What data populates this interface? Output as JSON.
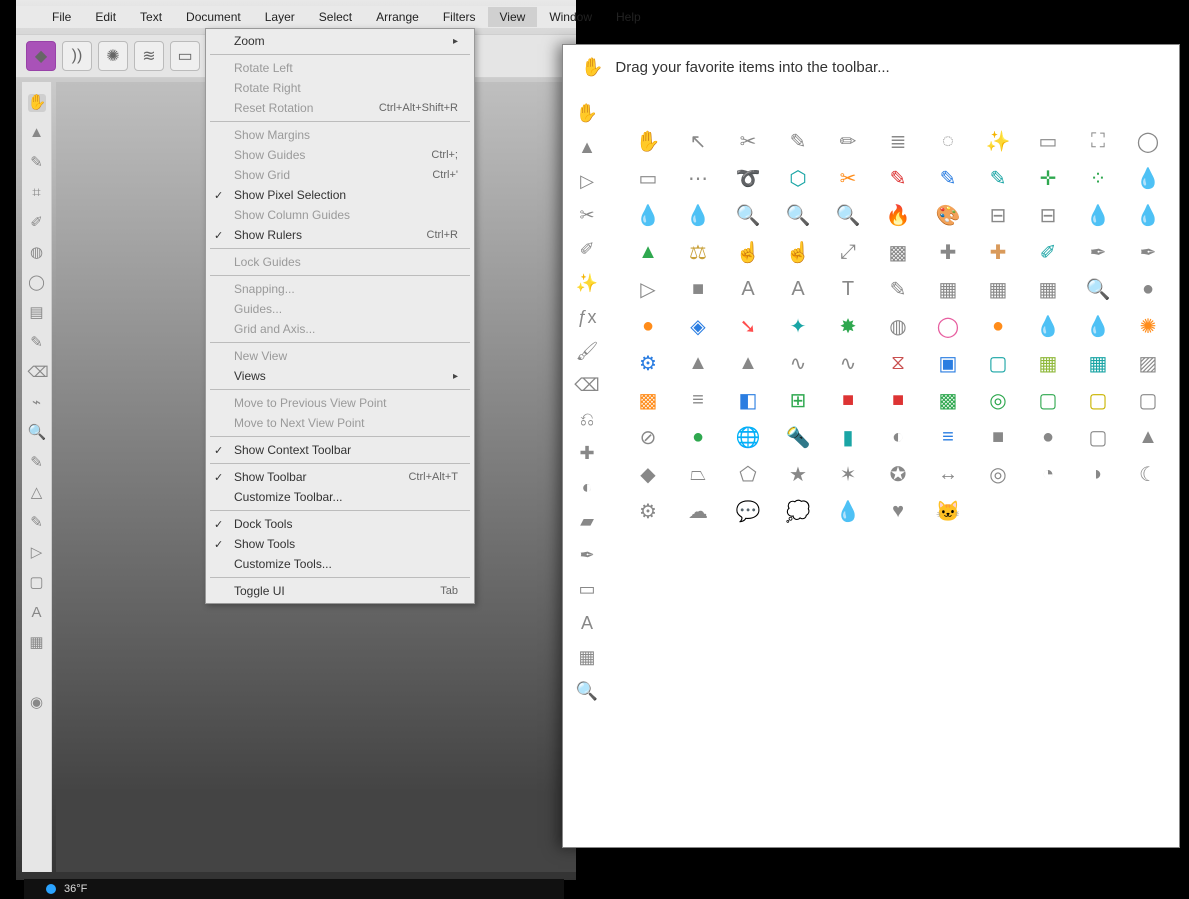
{
  "menubar": {
    "items": [
      "File",
      "Edit",
      "Text",
      "Document",
      "Layer",
      "Select",
      "Arrange",
      "Filters",
      "View",
      "Window",
      "Help"
    ],
    "active": "View"
  },
  "view_menu": {
    "groups": [
      [
        {
          "label": "Zoom",
          "arrow": true,
          "dim": false
        }
      ],
      [
        {
          "label": "Rotate Left",
          "dim": true
        },
        {
          "label": "Rotate Right",
          "dim": true
        },
        {
          "label": "Reset Rotation",
          "shortcut": "Ctrl+Alt+Shift+R",
          "dim": true
        }
      ],
      [
        {
          "label": "Show Margins",
          "dim": true
        },
        {
          "label": "Show Guides",
          "shortcut": "Ctrl+;",
          "dim": true
        },
        {
          "label": "Show Grid",
          "shortcut": "Ctrl+'",
          "dim": true
        },
        {
          "label": "Show Pixel Selection",
          "checked": true
        },
        {
          "label": "Show Column Guides",
          "dim": true
        },
        {
          "label": "Show Rulers",
          "shortcut": "Ctrl+R",
          "checked": true
        }
      ],
      [
        {
          "label": "Lock Guides",
          "dim": true
        }
      ],
      [
        {
          "label": "Snapping...",
          "dim": true
        },
        {
          "label": "Guides...",
          "dim": true
        },
        {
          "label": "Grid and Axis...",
          "dim": true
        }
      ],
      [
        {
          "label": "New View",
          "dim": true
        },
        {
          "label": "Views",
          "arrow": true
        }
      ],
      [
        {
          "label": "Move to Previous View Point",
          "dim": true
        },
        {
          "label": "Move to Next View Point",
          "dim": true
        }
      ],
      [
        {
          "label": "Show Context Toolbar",
          "checked": true
        }
      ],
      [
        {
          "label": "Show Toolbar",
          "shortcut": "Ctrl+Alt+T",
          "checked": true
        },
        {
          "label": "Customize Toolbar..."
        }
      ],
      [
        {
          "label": "Dock Tools",
          "checked": true
        },
        {
          "label": "Show Tools",
          "checked": true
        },
        {
          "label": "Customize Tools..."
        }
      ],
      [
        {
          "label": "Toggle UI",
          "shortcut": "Tab"
        }
      ]
    ]
  },
  "customize_panel": {
    "title": "Drag your favorite items into the toolbar...",
    "side_tools": [
      "hand-icon",
      "move-icon",
      "node-icon",
      "crop-icon",
      "selection-brush-icon",
      "magic-wand-icon",
      "fx-icon",
      "paint-brush-icon",
      "erase-icon",
      "clone-icon",
      "inpaint-icon",
      "dodge-icon",
      "fill-icon",
      "pen-icon",
      "rectangle-icon",
      "frame-text-icon",
      "mesh-warp-icon",
      "zoom-icon"
    ],
    "grid_tools": [
      "hand-icon",
      "move-pointer-icon",
      "crop-icon",
      "brush-light-icon",
      "brush-dark-icon",
      "list-icon",
      "dashed-circle-icon",
      "wand-icon",
      "marquee-rect-icon",
      "marquee-dotted-icon",
      "ellipse-dotted-icon",
      "rect-dash-icon",
      "line-dash-icon",
      "lasso-icon",
      "poly-lasso-icon",
      "scissors-icon",
      "brush-red-icon",
      "brush-blue-icon",
      "overlay-brush-icon",
      "crosshair-icon",
      "color-dots-icon",
      "eyedrop-orange-icon",
      "eyedrop-blue-icon",
      "eyedrop-orange2-icon",
      "eyedrop-lens-icon",
      "lens-blue-icon",
      "lens-teal-icon",
      "flame-icon",
      "palette-icon",
      "stamp-icon",
      "stamp2-icon",
      "drop-blue-icon",
      "drop-grey-icon",
      "triangle-green-icon",
      "scales-icon",
      "smudge-hand-icon",
      "smudge-dark-icon",
      "diag-arrows-icon",
      "checker-icon",
      "bandage-icon",
      "bandage-color-icon",
      "swirl-icon",
      "pen-dark-icon",
      "fountain-pen-icon",
      "play-icon",
      "square-solid-icon",
      "a-box-icon",
      "a-box2-icon",
      "t-box-icon",
      "brush-small-icon",
      "mesh-icon",
      "mesh-warp-icon",
      "mesh-teal-icon",
      "lens-teal2-icon",
      "blur-circle-icon",
      "orange-glow-icon",
      "cube-icon",
      "red-trail-icon",
      "burst-teal-icon",
      "burst-green-icon",
      "aperture-icon",
      "ring-pink-icon",
      "glow-orange-icon",
      "drop-plus-icon",
      "drop-minus-icon",
      "burst-orange-icon",
      "gear-blue-icon",
      "pyramid-grey-icon",
      "pyramid-dots-icon",
      "wave-icon",
      "wave2-icon",
      "pinch-icon",
      "ring-square-icon",
      "frame-teal-icon",
      "grid-green-icon",
      "grid-teal-icon",
      "grid-diag-icon",
      "checker-orange-icon",
      "lines-icon",
      "gradient-icon",
      "h-adjust-icon",
      "red-square-icon",
      "red-solid-icon",
      "green-dots-icon",
      "rings-green-icon",
      "green-squares-icon",
      "yellow-square-icon",
      "grey-outline-icon",
      "no-circle-icon",
      "green-circle-icon",
      "globe-icon",
      "flashlight-icon",
      "teal-panel-icon",
      "half-circle-icon",
      "lines-blue-icon",
      "grey-square-icon",
      "grey-circle-icon",
      "grey-rounded-icon",
      "grey-triangle-icon",
      "diamond-icon",
      "trapezoid-icon",
      "pentagon-icon",
      "star-icon",
      "burst-icon",
      "badge-icon",
      "double-arrow-icon",
      "donut-icon",
      "pie-icon",
      "segment-icon",
      "crescent-icon",
      "gear-icon",
      "cloud-icon",
      "speech-icon",
      "speech-round-icon",
      "drop-icon",
      "heart-icon",
      "cat-icon",
      "",
      "",
      "",
      ""
    ]
  },
  "tool_strip": [
    "hand-icon",
    "move-icon",
    "brush-icon",
    "crop-icon",
    "selection-brush-icon",
    "flood-icon",
    "ellipse-icon",
    "gradient-icon",
    "paint-icon",
    "erase-icon",
    "clone-icon",
    "lens-icon",
    "inpaint-icon",
    "dodge-icon",
    "eyedrop-icon",
    "pen-icon",
    "node-icon",
    "rect-icon",
    "frame-text-icon",
    "mesh-icon",
    "",
    "color-swatch-icon"
  ],
  "taskbar": {
    "temp": "36°F"
  }
}
